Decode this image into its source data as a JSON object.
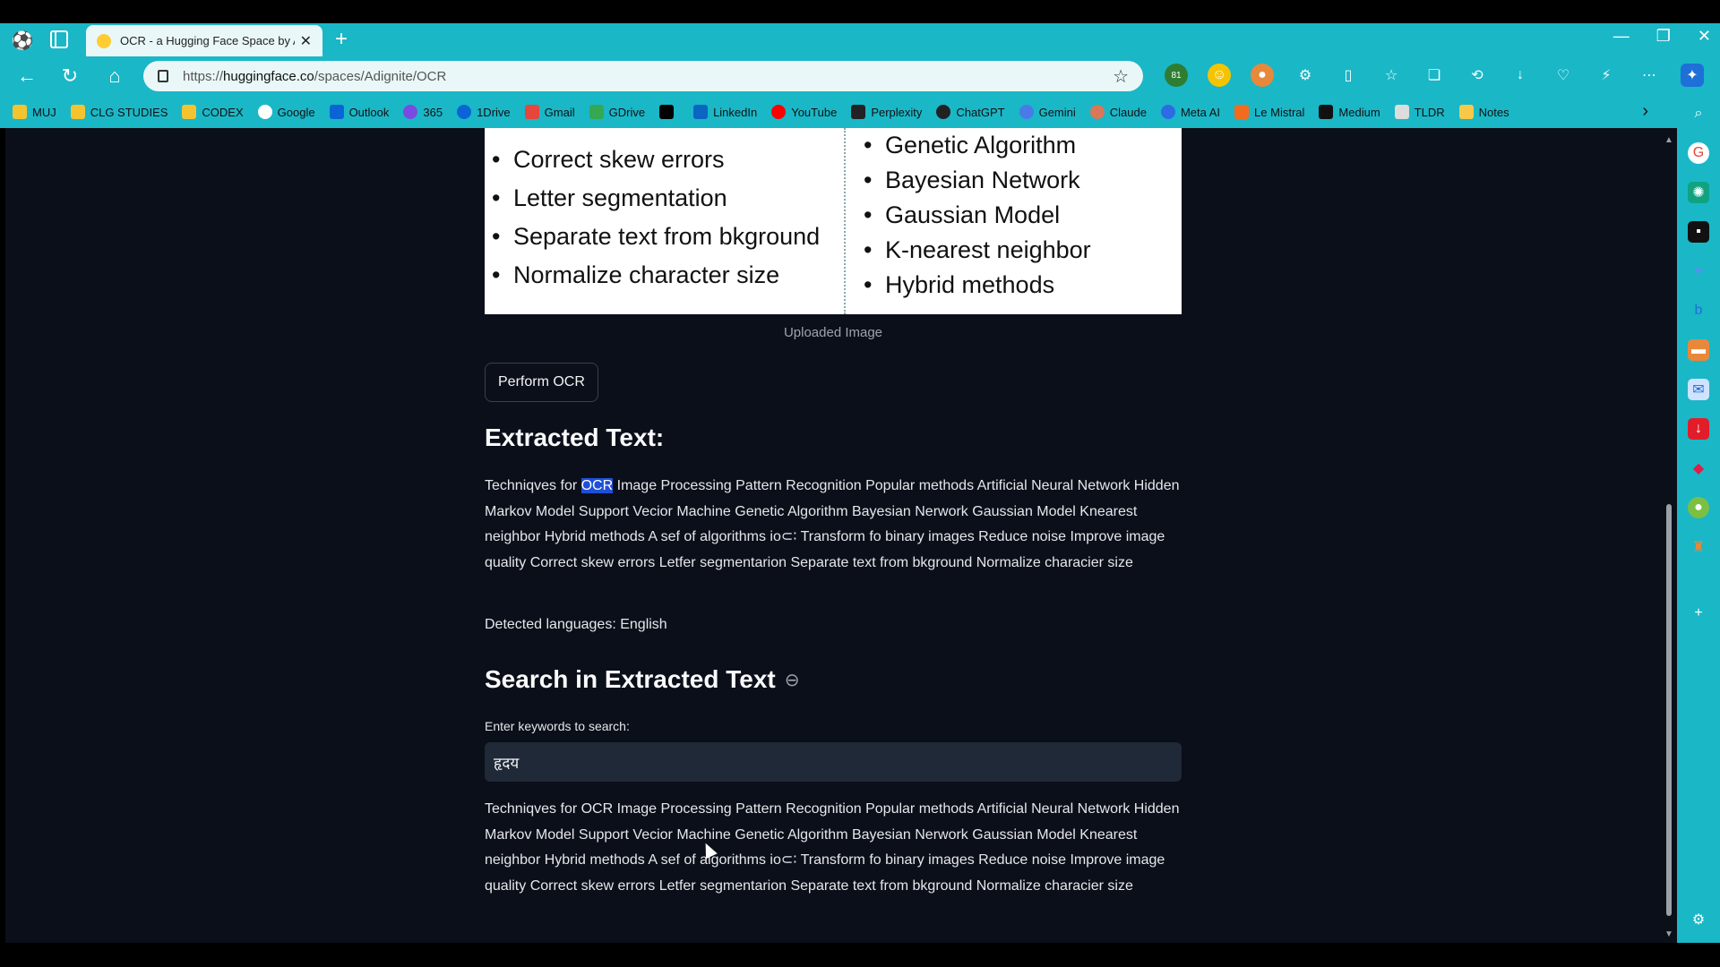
{
  "browser": {
    "tab_title": "OCR - a Hugging Face Space by A",
    "url_prefix": "https://",
    "url_domain": "huggingface.co",
    "url_path": "/spaces/Adignite/OCR",
    "ext_badge": "81"
  },
  "bookmarks": [
    {
      "label": "MUJ",
      "icon": "folder-icon"
    },
    {
      "label": "CLG STUDIES",
      "icon": "folder-icon"
    },
    {
      "label": "CODEX",
      "icon": "folder-icon"
    },
    {
      "label": "Google",
      "icon": "google-icon"
    },
    {
      "label": "Outlook",
      "icon": "outlook-icon"
    },
    {
      "label": "365",
      "icon": "m365-icon"
    },
    {
      "label": "1Drive",
      "icon": "onedrive-icon"
    },
    {
      "label": "Gmail",
      "icon": "gmail-icon"
    },
    {
      "label": "GDrive",
      "icon": "gdrive-icon"
    },
    {
      "label": "",
      "icon": "x-icon"
    },
    {
      "label": "LinkedIn",
      "icon": "linkedin-icon"
    },
    {
      "label": "YouTube",
      "icon": "youtube-icon"
    },
    {
      "label": "Perplexity",
      "icon": "perplexity-icon"
    },
    {
      "label": "ChatGPT",
      "icon": "chatgpt-icon"
    },
    {
      "label": "Gemini",
      "icon": "gemini-icon"
    },
    {
      "label": "Claude",
      "icon": "claude-icon"
    },
    {
      "label": "Meta AI",
      "icon": "metaai-icon"
    },
    {
      "label": "Le Mistral",
      "icon": "mistral-icon"
    },
    {
      "label": "Medium",
      "icon": "medium-icon"
    },
    {
      "label": "TLDR",
      "icon": "tldr-icon"
    },
    {
      "label": "Notes",
      "icon": "notes-icon"
    }
  ],
  "image": {
    "left_items": [
      "Correct skew errors",
      "Letter segmentation",
      "Separate text from bkground",
      "Normalize character size"
    ],
    "right_items": [
      "Genetic Algorithm",
      "Bayesian Network",
      "Gaussian Model",
      "K-nearest neighbor",
      "Hybrid methods"
    ],
    "caption": "Uploaded Image"
  },
  "actions": {
    "perform_ocr": "Perform OCR"
  },
  "extracted": {
    "heading": "Extracted Text:",
    "text_before": "Techniqves for ",
    "text_highlight": "OCR",
    "text_after": " Image Processing Pattern Recognition Popular methods Artificial Neural Network Hidden Markov Model Support Vecior Machine Genetic Algorithm Bayesian Nerwork Gaussian Model Knearest neighbor Hybrid methods A sef of algorithms io⊂∶ Transform fo binary images Reduce noise Improve image quality Correct skew errors Letfer segmentarion Separate text from bkground Normalize characier size",
    "detected_languages": "Detected languages: English"
  },
  "search": {
    "heading": "Search in Extracted Text",
    "label": "Enter keywords to search:",
    "value": "हृदय",
    "result": "Techniqves for OCR Image Processing Pattern Recognition Popular methods Artificial Neural Network Hidden Markov Model Support Vecior Machine Genetic Algorithm Bayesian Nerwork Gaussian Model Knearest neighbor Hybrid methods A sef of algorithms io⊂∶ Transform fo binary images Reduce noise Improve image quality Correct skew errors Letfer segmentarion Separate text from bkground Normalize characier size"
  },
  "colors": {
    "browser_chrome": "#1ab7c7",
    "page_bg": "#0b0f19",
    "highlight": "#1e4fd8"
  }
}
